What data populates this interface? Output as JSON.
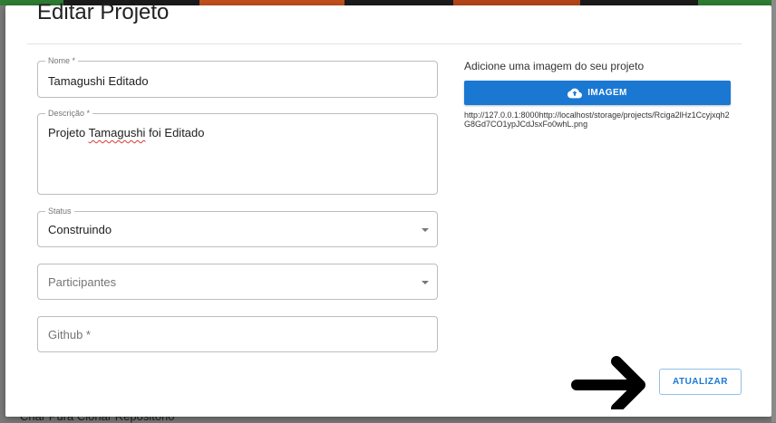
{
  "background": {
    "footer_text": "Criar Pura Clonar Repositório",
    "strip_colors": [
      "#2e7d32",
      "#1b1b1b",
      "#c0501e",
      "#1b1b1b",
      "#b4461a",
      "#1b1b1b",
      "#2e7d32"
    ]
  },
  "modal": {
    "title": "Editar Projeto",
    "fields": {
      "nome": {
        "label": "Nome *",
        "value": "Tamagushi Editado"
      },
      "descricao": {
        "label": "Descrição *",
        "value_prefix": "Projeto ",
        "value_flagged": "Tamagushi",
        "value_suffix": " foi Editado"
      },
      "status": {
        "label": "Status",
        "value": "Construindo"
      },
      "participantes": {
        "placeholder": "Participantes"
      },
      "github": {
        "placeholder": "Github *"
      }
    },
    "image": {
      "label": "Adicione uma imagem do seu projeto",
      "button_label": "IMAGEM",
      "url": "http://127.0.0.1:8000http://localhost/storage/projects/Rciga2lHz1Ccyjxqh2G8Gd7CO1ypJCdJsxFo0whL.png"
    },
    "submit_label": "ATUALIZAR"
  },
  "colors": {
    "accent": "#1a78d3",
    "arrow": "#000000"
  },
  "icons": {
    "upload": "cloud-upload-icon",
    "dropdown": "caret-down-icon",
    "pointer": "right-arrow-icon"
  }
}
